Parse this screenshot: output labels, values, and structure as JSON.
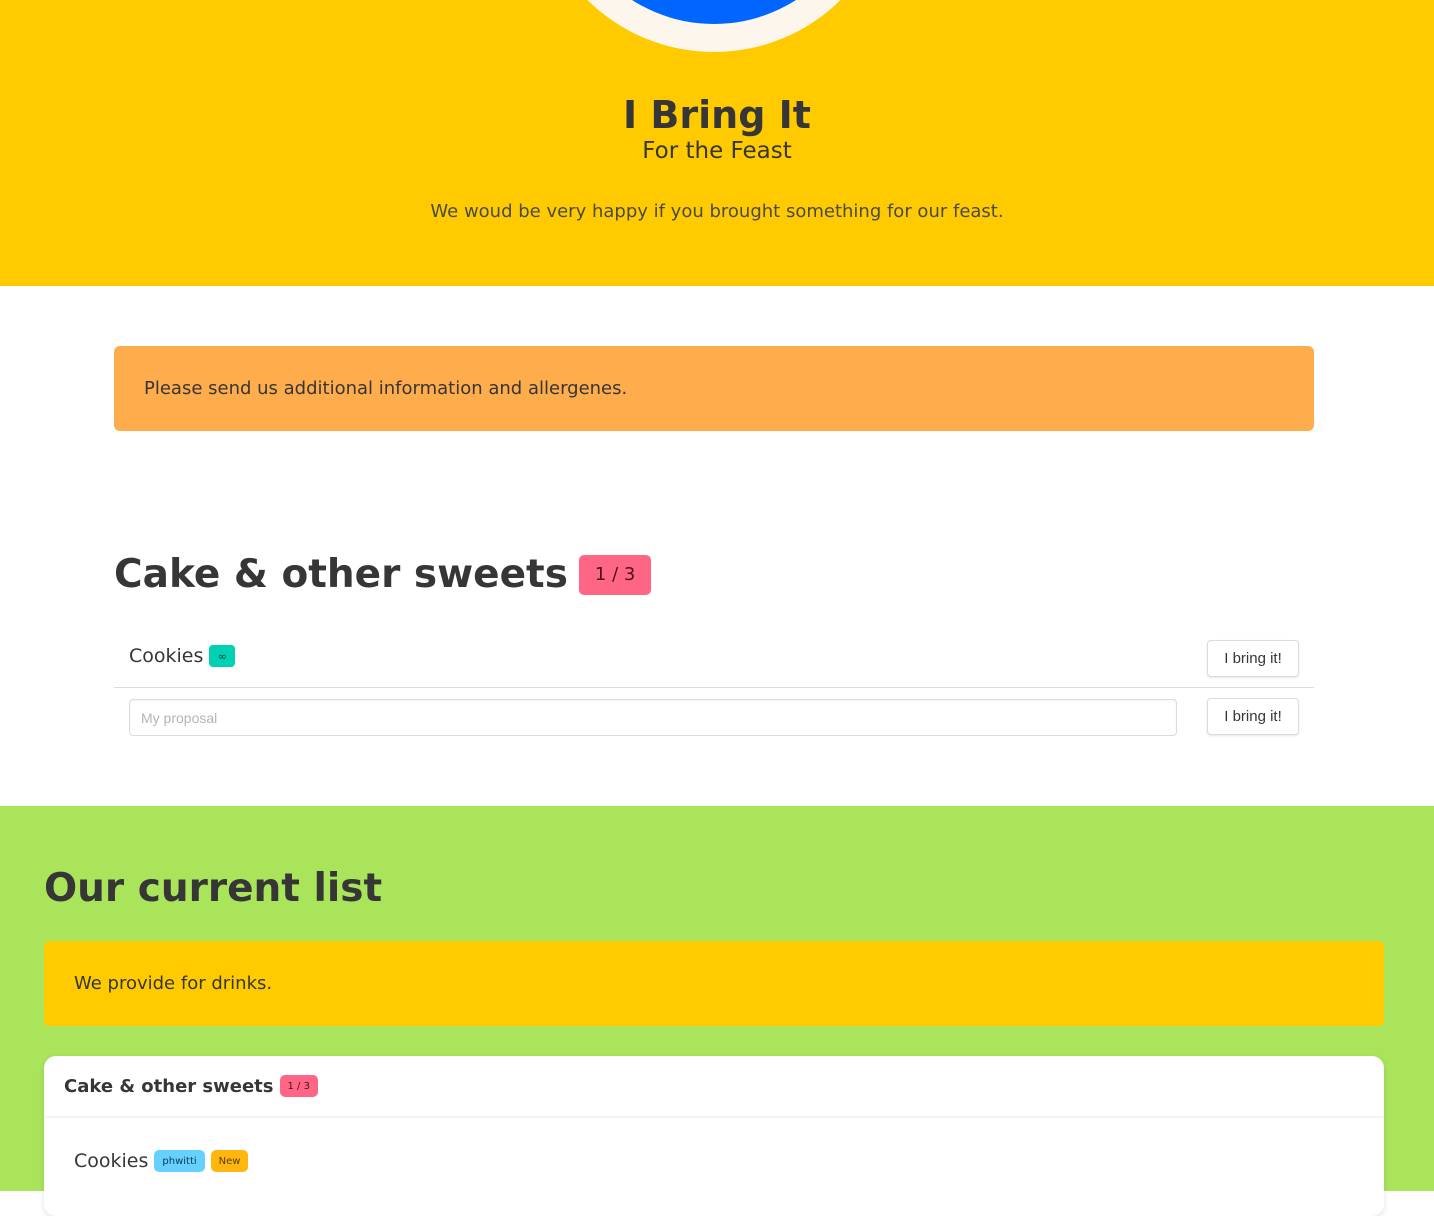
{
  "hero": {
    "title": "I Bring It",
    "subtitle": "For the Feast",
    "intro": "We woud be very happy if you brought something for our feast.",
    "logo_icon": "peace-logo-icon",
    "bg_color": "#ffcb00"
  },
  "notice_top": {
    "text": "Please send us additional information and allergenes."
  },
  "category": {
    "title": "Cake & other sweets",
    "count": "1 / 3",
    "items": [
      {
        "name": "Cookies",
        "tag": "∞",
        "button": "I bring it!"
      }
    ],
    "proposal": {
      "placeholder": "My proposal",
      "value": "",
      "button": "I bring it!"
    }
  },
  "current_list": {
    "title": "Our current list",
    "notice": "We provide for drinks.",
    "card": {
      "title": "Cake & other sweets",
      "count": "1 / 3",
      "items": [
        {
          "name": "Cookies",
          "user": "phwitti",
          "status": "New"
        }
      ]
    },
    "bg_color": "#a9e45b"
  }
}
